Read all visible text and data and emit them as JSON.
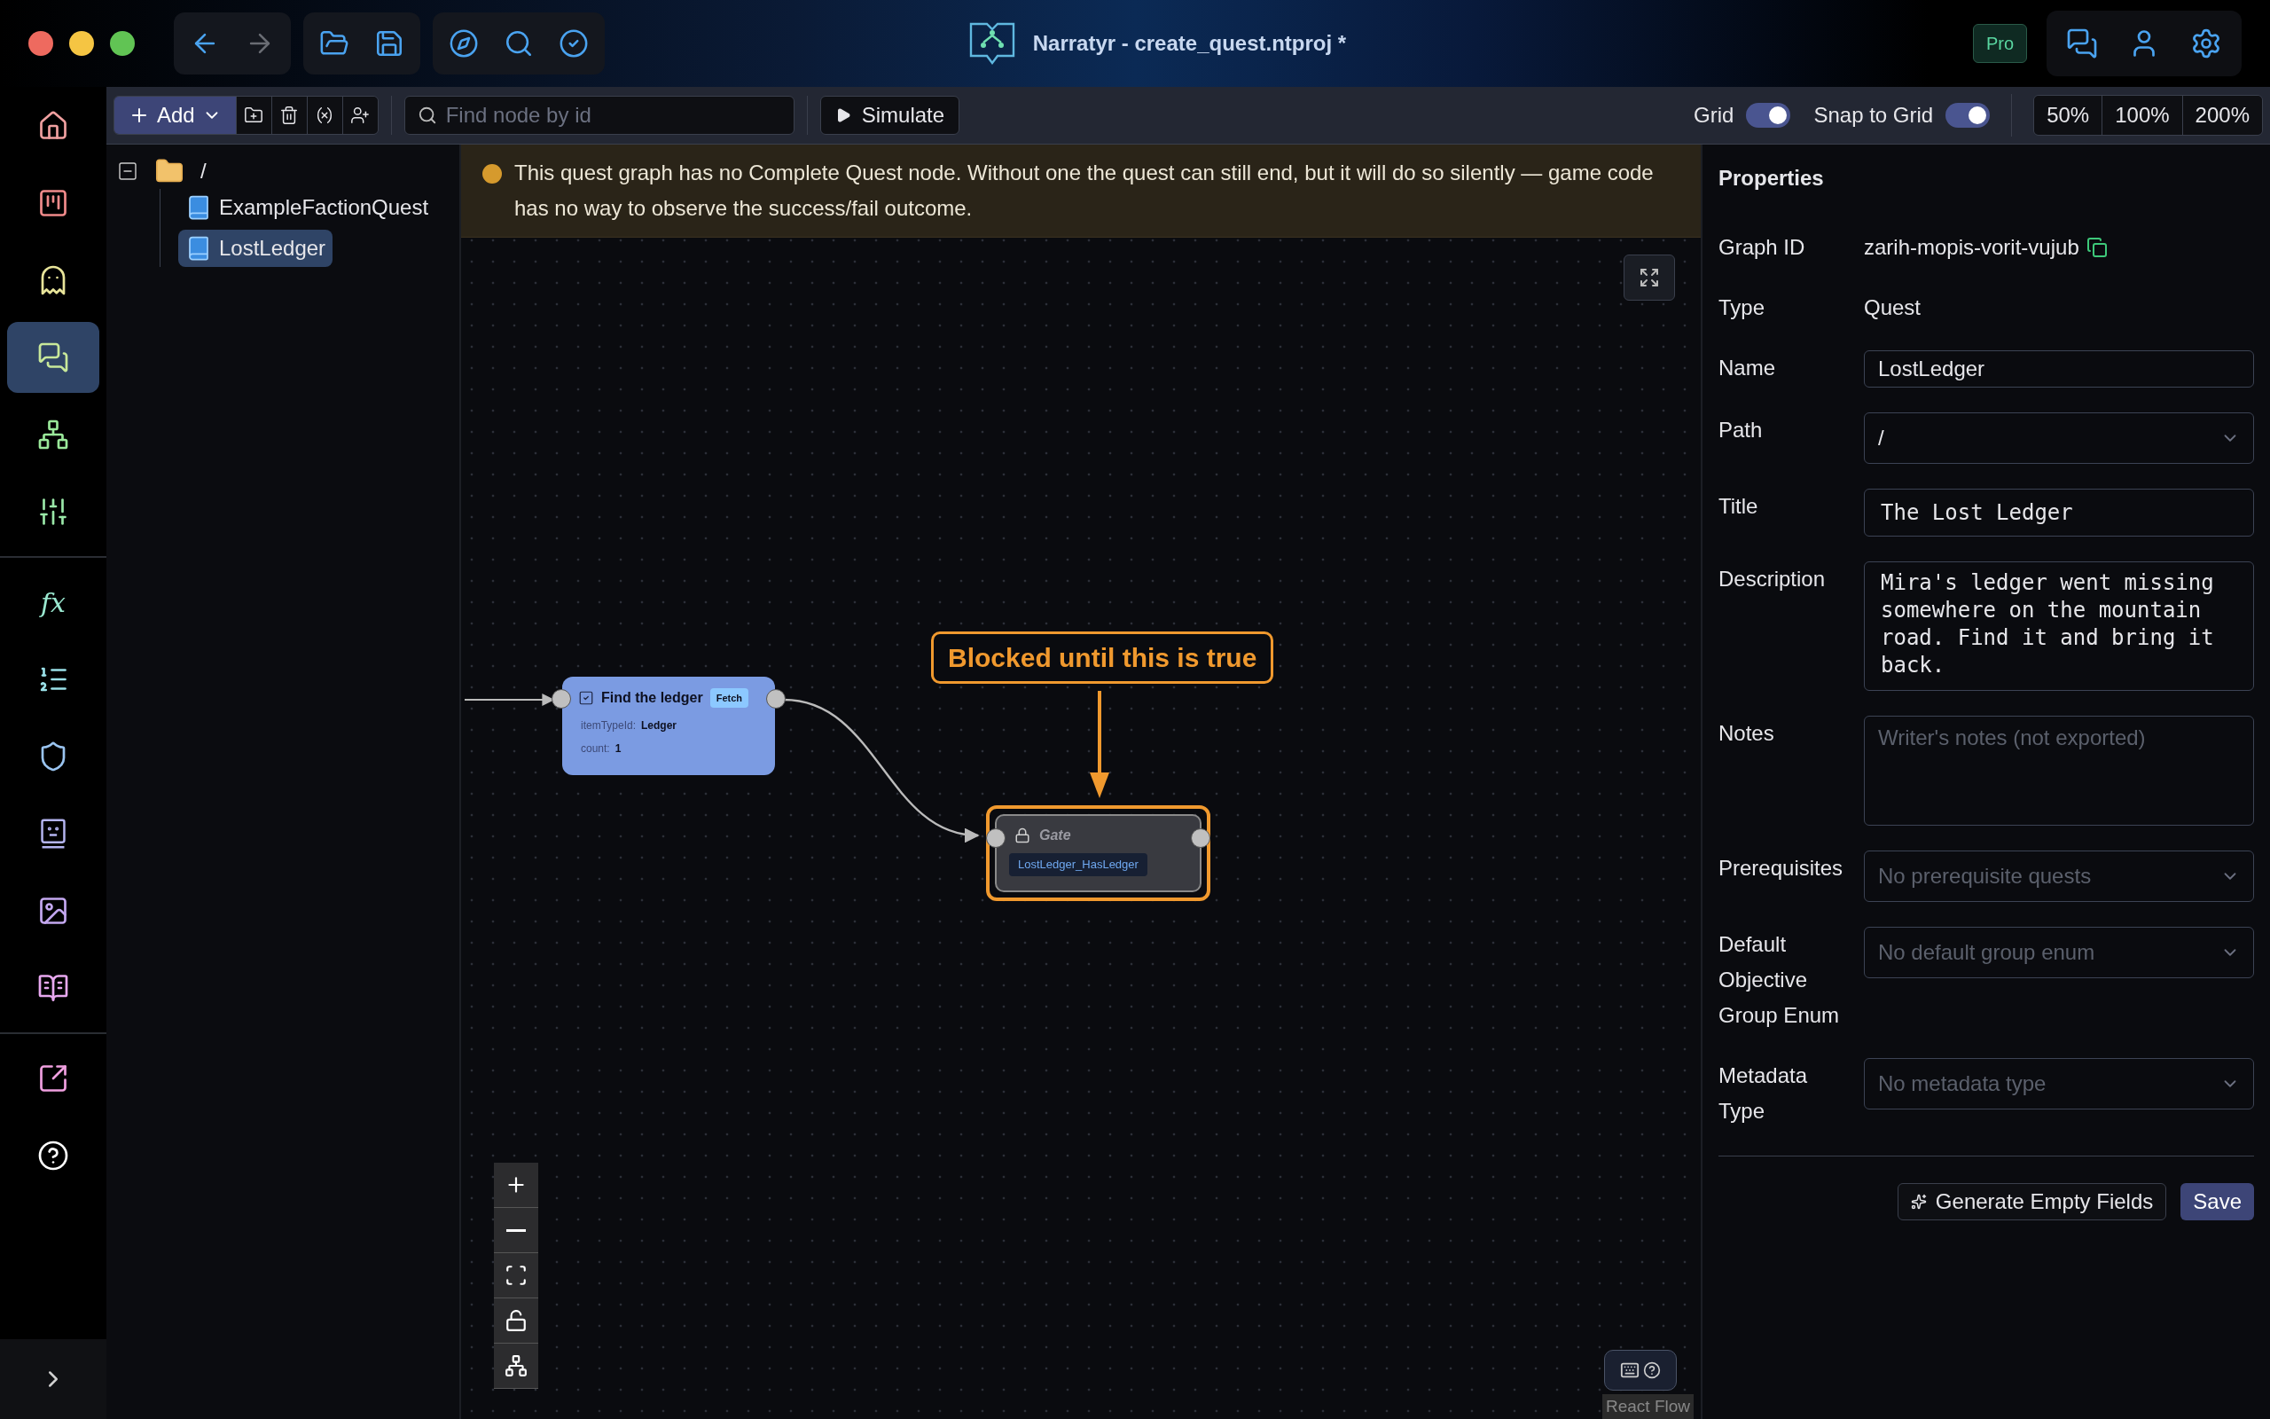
{
  "window": {
    "title": "Narratyr - create_quest.ntproj *",
    "badge": "Pro"
  },
  "nav_groups": [
    [
      {
        "kind": "back",
        "disabled": false
      },
      {
        "kind": "forward",
        "disabled": true
      }
    ],
    [
      {
        "kind": "open",
        "disabled": false
      },
      {
        "kind": "save",
        "disabled": false
      }
    ],
    [
      {
        "kind": "compass",
        "disabled": false
      },
      {
        "kind": "search",
        "disabled": false
      },
      {
        "kind": "check",
        "disabled": false
      }
    ]
  ],
  "right_icons": [
    {
      "kind": "chat"
    },
    {
      "kind": "user"
    },
    {
      "kind": "settings"
    }
  ],
  "rail": {
    "groups": [
      [
        {
          "kind": "home",
          "selected": false
        },
        {
          "kind": "board",
          "selected": false
        },
        {
          "kind": "ghost",
          "selected": false
        },
        {
          "kind": "chat",
          "selected": true
        },
        {
          "kind": "hierarchy",
          "selected": false
        },
        {
          "kind": "sliders",
          "selected": false
        }
      ],
      [
        {
          "kind": "fx",
          "label": "fx",
          "selected": false
        },
        {
          "kind": "list",
          "selected": false
        },
        {
          "kind": "shield",
          "selected": false
        },
        {
          "kind": "face",
          "selected": false
        },
        {
          "kind": "image",
          "selected": false
        },
        {
          "kind": "book",
          "selected": false
        }
      ],
      [
        {
          "kind": "export",
          "selected": false
        },
        {
          "kind": "help",
          "selected": false
        }
      ]
    ]
  },
  "toolbar": {
    "add": "Add",
    "tools": [
      {
        "kind": "new-folder"
      },
      {
        "kind": "delete"
      },
      {
        "kind": "variables"
      },
      {
        "kind": "add-user"
      }
    ],
    "search": {
      "placeholder": "Find node by id"
    },
    "simulate": "Simulate",
    "toggles": [
      {
        "label": "Grid",
        "on": true
      },
      {
        "label": "Snap to Grid",
        "on": true
      }
    ],
    "zoom_levels": [
      "50%",
      "100%",
      "200%"
    ]
  },
  "tree": {
    "label": "/",
    "expanded": true,
    "children": [
      {
        "label": "ExampleFactionQuest",
        "selected": false
      },
      {
        "label": "LostLedger",
        "selected": true
      }
    ]
  },
  "canvas": {
    "warning": "This quest graph has no Complete Quest node. Without one the quest can still end, but it will do so silently — game code has no way to observe the success/fail outcome.",
    "nodes": [
      {
        "kind": "objective",
        "title": "Find the ledger",
        "tag": "Fetch",
        "checked": true,
        "fields": [
          {
            "key": "itemTypeId:",
            "value": "Ledger"
          },
          {
            "key": "count:",
            "value": "1"
          }
        ]
      },
      {
        "kind": "gate",
        "title": "Gate",
        "condition": "LostLedger_HasLedger",
        "highlighted": true
      }
    ],
    "callout": "Blocked until this is true",
    "controls": [
      {
        "kind": "zoom-in"
      },
      {
        "kind": "zoom-out"
      },
      {
        "kind": "fit"
      },
      {
        "kind": "unlock"
      },
      {
        "kind": "layout"
      }
    ],
    "attribution": "React Flow"
  },
  "properties": {
    "title": "Properties",
    "rows": [
      {
        "kind": "text",
        "label": "Graph ID",
        "value": "zarih-mopis-vorit-vujub",
        "copy": true
      },
      {
        "kind": "text",
        "label": "Type",
        "value": "Quest",
        "copy": false
      },
      {
        "kind": "input",
        "label": "Name",
        "value": "LostLedger"
      },
      {
        "kind": "select",
        "label": "Path",
        "value": "/"
      },
      {
        "kind": "mono-input",
        "label": "Title",
        "value": "The Lost Ledger"
      },
      {
        "kind": "textarea",
        "label": "Description",
        "value": "Mira's ledger went missing somewhere on the mountain road. Find it and bring it back."
      },
      {
        "kind": "textarea",
        "label": "Notes",
        "placeholder": "Writer's notes (not exported)"
      },
      {
        "kind": "select",
        "label": "Prerequisites",
        "placeholder": "No prerequisite quests"
      },
      {
        "kind": "select",
        "label": "Default Objective Group Enum",
        "placeholder": "No default group enum"
      },
      {
        "kind": "select",
        "label": "Metadata Type",
        "placeholder": "No metadata type"
      }
    ],
    "buttons": [
      {
        "kind": "secondary",
        "label": "Generate Empty Fields"
      },
      {
        "kind": "primary",
        "label": "Save"
      }
    ]
  }
}
